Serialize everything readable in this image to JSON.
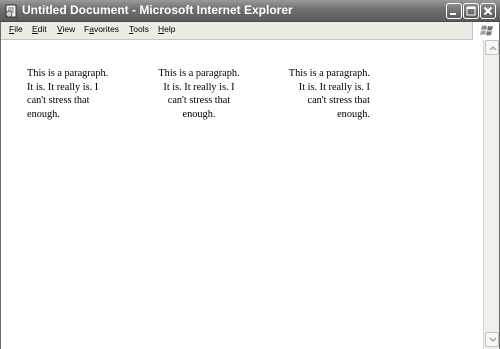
{
  "window": {
    "title": "Untitled Document - Microsoft Internet Explorer",
    "app_icon": "ie-document-icon",
    "controls": [
      "minimize-icon",
      "maximize-icon",
      "close-icon"
    ]
  },
  "menu": {
    "items": [
      {
        "access": "F",
        "rest": "ile"
      },
      {
        "access": "E",
        "rest": "dit"
      },
      {
        "access": "V",
        "rest": "iew"
      },
      {
        "pre": "F",
        "access": "a",
        "rest": "vorites"
      },
      {
        "access": "T",
        "rest": "ools"
      },
      {
        "access": "H",
        "rest": "elp"
      }
    ],
    "logo": "windows-flag-icon"
  },
  "content": {
    "paragraphs": [
      {
        "align": "left",
        "text": "This is a paragraph. It is. It really is. I can't stress that enough."
      },
      {
        "align": "center",
        "text": "This is a paragraph. It is. It really is. I can't stress that enough."
      },
      {
        "align": "right",
        "text": "This is a paragraph. It is. It really is. I can't stress that enough."
      }
    ]
  },
  "scrollbar": {
    "up_icon": "scroll-up-arrow-icon",
    "down_icon": "scroll-down-arrow-icon"
  }
}
